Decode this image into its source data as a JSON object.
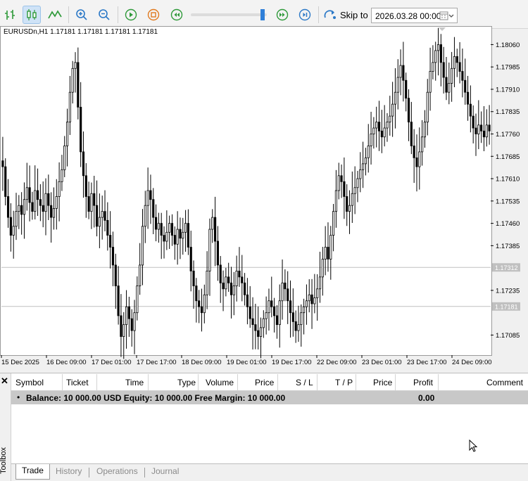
{
  "toolbar": {
    "skip_to_label": "Skip to",
    "date_value": "2026.03.28 00:00",
    "slider_fraction": 0.93
  },
  "chart": {
    "symbol_info": "EURUSDn,H1  1.17181 1.17181 1.17181 1.17181",
    "price_labels": [
      "1.18060",
      "1.17985",
      "1.17910",
      "1.17835",
      "1.17760",
      "1.17685",
      "1.17610",
      "1.17535",
      "1.17460",
      "1.17385",
      "1.17235",
      "1.17085"
    ],
    "level_labels": [
      "1.17312",
      "1.17181"
    ],
    "time_labels": [
      "15 Dec 2025",
      "16 Dec 09:00",
      "17 Dec 01:00",
      "17 Dec 17:00",
      "18 Dec 09:00",
      "19 Dec 01:00",
      "19 Dec 17:00",
      "22 Dec 09:00",
      "23 Dec 01:00",
      "23 Dec 17:00",
      "24 Dec 09:00"
    ]
  },
  "chart_data": {
    "type": "candlestick",
    "price_range": [
      1.1702,
      1.1812
    ],
    "levels": [
      1.17312,
      1.17181
    ],
    "closes": [
      1.1765,
      1.1755,
      1.1748,
      1.1742,
      1.1745,
      1.175,
      1.1752,
      1.1749,
      1.1754,
      1.1758,
      1.1753,
      1.175,
      1.1757,
      1.1754,
      1.1752,
      1.175,
      1.1756,
      1.1752,
      1.1748,
      1.1751,
      1.1755,
      1.176,
      1.1764,
      1.1772,
      1.178,
      1.179,
      1.1798,
      1.18,
      1.1785,
      1.177,
      1.1762,
      1.1755,
      1.175,
      1.1756,
      1.1752,
      1.1745,
      1.1748,
      1.175,
      1.1747,
      1.1742,
      1.1738,
      1.1732,
      1.1725,
      1.1715,
      1.1708,
      1.1712,
      1.1718,
      1.1714,
      1.171,
      1.1716,
      1.1725,
      1.1732,
      1.1745,
      1.1752,
      1.1757,
      1.1754,
      1.1748,
      1.1744,
      1.1746,
      1.1742,
      1.174,
      1.1743,
      1.1746,
      1.1742,
      1.1739,
      1.1744,
      1.1741,
      1.1743,
      1.1746,
      1.1738,
      1.173,
      1.1725,
      1.172,
      1.1718,
      1.1716,
      1.1722,
      1.173,
      1.1744,
      1.1748,
      1.174,
      1.1732,
      1.1726,
      1.1724,
      1.1728,
      1.1726,
      1.1722,
      1.1725,
      1.173,
      1.1728,
      1.1726,
      1.1722,
      1.1718,
      1.1714,
      1.1712,
      1.171,
      1.1708,
      1.1711,
      1.1714,
      1.1716,
      1.172,
      1.1718,
      1.1715,
      1.1712,
      1.172,
      1.1726,
      1.1724,
      1.172,
      1.1716,
      1.1713,
      1.171,
      1.1712,
      1.1716,
      1.1718,
      1.172,
      1.1722,
      1.1719,
      1.1721,
      1.1724,
      1.1728,
      1.1734,
      1.1738,
      1.1734,
      1.1742,
      1.175,
      1.1757,
      1.1762,
      1.176,
      1.1755,
      1.175,
      1.1752,
      1.1756,
      1.1758,
      1.1761,
      1.1764,
      1.1766,
      1.1768,
      1.1772,
      1.1776,
      1.1778,
      1.178,
      1.1777,
      1.1775,
      1.1778,
      1.178,
      1.1782,
      1.1786,
      1.179,
      1.1795,
      1.1799,
      1.1794,
      1.1788,
      1.178,
      1.1772,
      1.1768,
      1.1765,
      1.177,
      1.1775,
      1.178,
      1.179,
      1.1797,
      1.18,
      1.1804,
      1.1806,
      1.18,
      1.1795,
      1.179,
      1.1793,
      1.1798,
      1.1802,
      1.18,
      1.1797,
      1.1794,
      1.179,
      1.1786,
      1.1782,
      1.1778,
      1.1776,
      1.1779,
      1.1777,
      1.1775,
      1.1779,
      1.1777
    ]
  },
  "toolbox": {
    "side_label": "Toolbox",
    "columns": [
      "Symbol",
      "Ticket",
      "Time",
      "Type",
      "Volume",
      "Price",
      "S / L",
      "T / P",
      "Price",
      "Profit",
      "Comment"
    ],
    "balance_text": "Balance: 10 000.00 USD  Equity: 10 000.00  Free Margin: 10 000.00",
    "balance_profit": "0.00",
    "tabs": [
      "Trade",
      "History",
      "Operations",
      "Journal"
    ]
  }
}
